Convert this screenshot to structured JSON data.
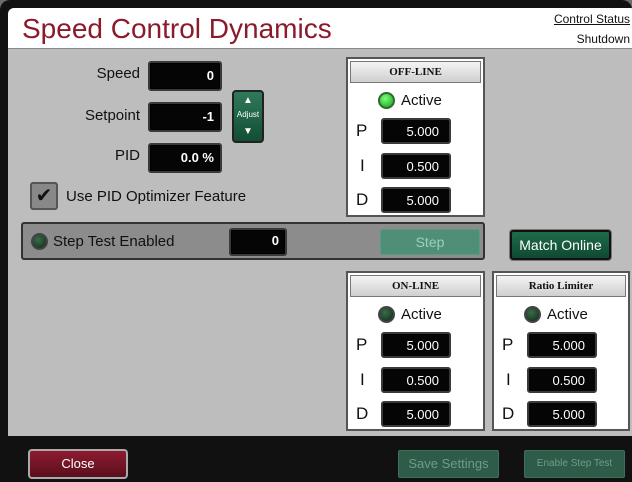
{
  "header": {
    "title": "Speed Control Dynamics",
    "status_label": "Control Status",
    "status_value": "Shutdown"
  },
  "fields": {
    "speed": {
      "label": "Speed",
      "value": "0"
    },
    "setpoint": {
      "label": "Setpoint",
      "value": "-1"
    },
    "pid": {
      "label": "PID",
      "value": "0.0 %"
    }
  },
  "adjust": {
    "label": "Adjust",
    "up_icon": "up-arrow-icon",
    "down_icon": "down-arrow-icon"
  },
  "optimizer": {
    "label": "Use PID Optimizer Feature",
    "checked": true
  },
  "step_test": {
    "label": "Step Test Enabled",
    "value": "0",
    "button": "Step",
    "led": "off"
  },
  "match_online": "Match Online",
  "offline": {
    "title": "OFF-LINE",
    "active_label": "Active",
    "led": "on",
    "p_label": "P",
    "p": "5.000",
    "i_label": "I",
    "i": "0.500",
    "d_label": "D",
    "d": "5.000"
  },
  "online": {
    "title": "ON-LINE",
    "active_label": "Active",
    "led": "off",
    "p_label": "P",
    "p": "5.000",
    "i_label": "I",
    "i": "0.500",
    "d_label": "D",
    "d": "5.000"
  },
  "ratio_limiter": {
    "title": "Ratio Limiter",
    "active_label": "Active",
    "led": "off",
    "p_label": "P",
    "p": "5.000",
    "i_label": "I",
    "i": "0.500",
    "d_label": "D",
    "d": "5.000"
  },
  "footer": {
    "close": "Close",
    "save": "Save Settings",
    "enable_step": "Enable Step Test"
  },
  "colors": {
    "title": "#8b1a2b",
    "accent_green": "#1f6b4a",
    "close_red": "#8e1b30"
  }
}
